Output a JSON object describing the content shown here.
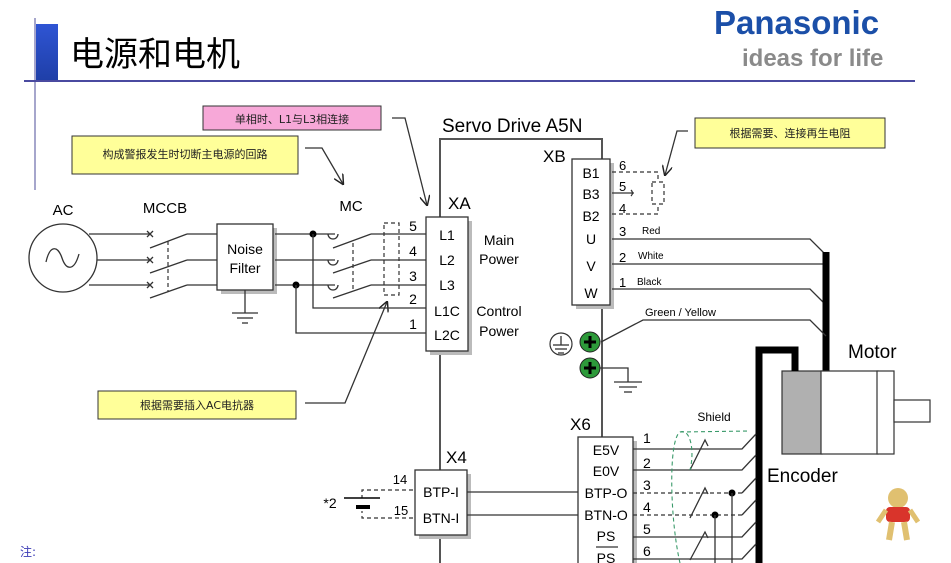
{
  "slide": {
    "title": "电源和电机",
    "brand": {
      "name": "Panasonic",
      "tagline": "ideas for life",
      "color": "#1b4fa8",
      "tagline_color": "#8a8a8a"
    },
    "accent_color": "#2f55d4",
    "footnote_label": "注:"
  },
  "callouts": {
    "single_phase": {
      "text": "单相时、L1与L3相连接",
      "bg": "#f7a8d8"
    },
    "alarm_cutoff": {
      "text": "构成警报发生时切断主电源的回路",
      "bg": "#ffff99"
    },
    "regen_resistor": {
      "text": "根据需要、连接再生电阻",
      "bg": "#ffff99"
    },
    "ac_reactor": {
      "text": "根据需要插入AC电抗器",
      "bg": "#ffff99"
    }
  },
  "diagram": {
    "servo_title": "Servo Drive A5N",
    "ac_label": "AC",
    "mccb_label": "MCCB",
    "noise_filter": [
      "Noise",
      "Filter"
    ],
    "mc_label": "MC",
    "xa": {
      "label": "XA",
      "pins": [
        {
          "num": "5",
          "name": "L1"
        },
        {
          "num": "4",
          "name": "L2"
        },
        {
          "num": "3",
          "name": "L3"
        },
        {
          "num": "2",
          "name": "L1C"
        },
        {
          "num": "1",
          "name": "L2C"
        }
      ],
      "main_power": [
        "Main",
        "Power"
      ],
      "control_power": [
        "Control",
        "Power"
      ]
    },
    "xb": {
      "label": "XB",
      "pins": [
        {
          "num": "6",
          "name": "B1"
        },
        {
          "num": "5",
          "name": "B3"
        },
        {
          "num": "4",
          "name": "B2"
        },
        {
          "num": "3",
          "name": "U",
          "wire": "Red"
        },
        {
          "num": "2",
          "name": "V",
          "wire": "White"
        },
        {
          "num": "1",
          "name": "W",
          "wire": "Black"
        }
      ],
      "ground_wire": "Green / Yellow"
    },
    "x4": {
      "label": "X4",
      "pins": [
        {
          "num": "14",
          "name": "BTP-I"
        },
        {
          "num": "15",
          "name": "BTN-I"
        }
      ],
      "battery_note": "*2"
    },
    "x6": {
      "label": "X6",
      "pins": [
        {
          "num": "1",
          "name": "E5V"
        },
        {
          "num": "2",
          "name": "E0V"
        },
        {
          "num": "3",
          "name": "BTP-O"
        },
        {
          "num": "4",
          "name": "BTN-O"
        },
        {
          "num": "5",
          "name": "PS"
        },
        {
          "num": "6",
          "name": "PS"
        }
      ],
      "shield": "Shield"
    },
    "motor_label": "Motor",
    "encoder_label": "Encoder"
  }
}
